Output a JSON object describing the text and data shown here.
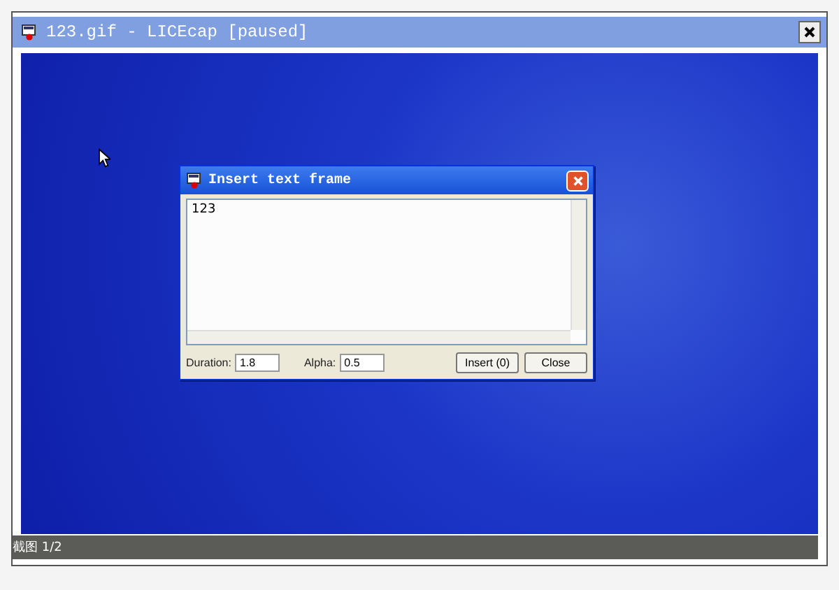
{
  "window": {
    "title": "123.gif - LICEcap [paused]"
  },
  "dialog": {
    "title": "Insert text frame",
    "text": "123",
    "duration_label": "Duration:",
    "duration": "1.8",
    "alpha_label": "Alpha:",
    "alpha": "0.5",
    "buttons": [
      "Insert (0)",
      "Close"
    ]
  },
  "status_bar": {
    "text": "截图 1/2"
  }
}
